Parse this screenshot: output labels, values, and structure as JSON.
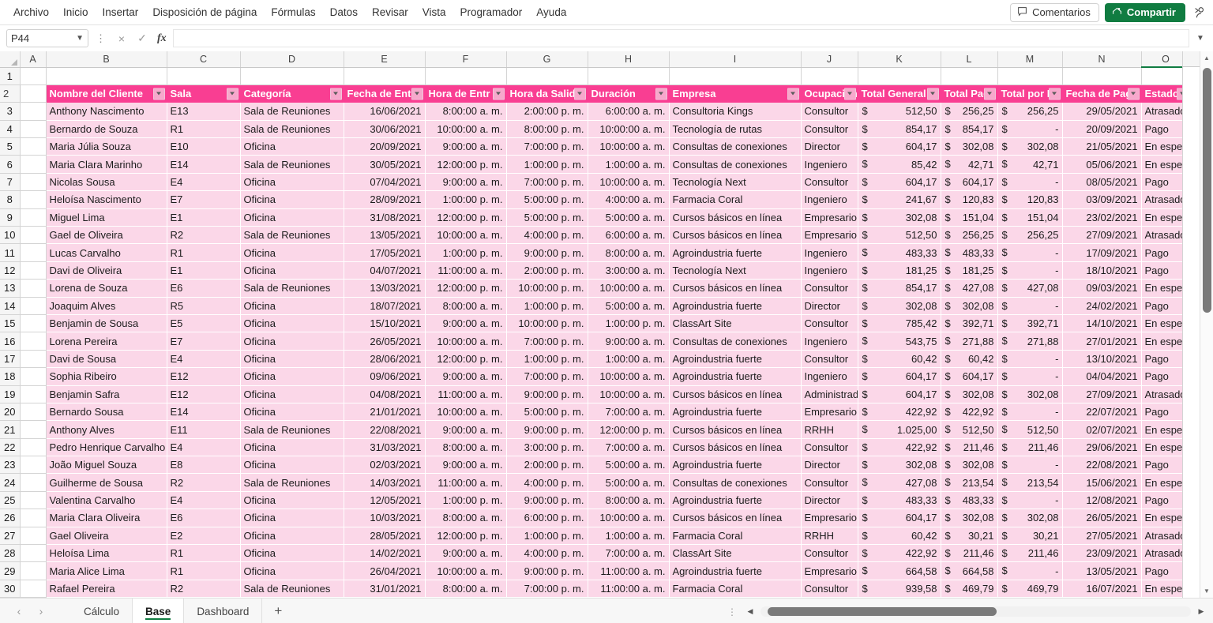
{
  "menu": {
    "items": [
      "Archivo",
      "Inicio",
      "Insertar",
      "Disposición de página",
      "Fórmulas",
      "Datos",
      "Revisar",
      "Vista",
      "Programador",
      "Ayuda"
    ],
    "comments_label": "Comentarios",
    "share_label": "Compartir"
  },
  "formula_bar": {
    "name_box": "P44",
    "formula": "",
    "cancel_icon": "×",
    "confirm_icon": "✓",
    "fx_label": "fx"
  },
  "grid": {
    "column_letters": [
      "A",
      "B",
      "C",
      "D",
      "E",
      "F",
      "G",
      "H",
      "I",
      "J",
      "K",
      "L",
      "M",
      "N",
      "O"
    ],
    "row_numbers": [
      1,
      2,
      3,
      4,
      5,
      6,
      7,
      8,
      9,
      10,
      11,
      12,
      13,
      14,
      15,
      16,
      17,
      18,
      19,
      20,
      21,
      22,
      23,
      24,
      25,
      26,
      27,
      28,
      29,
      30
    ],
    "header_row_index": 2,
    "header_fill": "#f93e92",
    "data_fill": "#fbd7e8",
    "headers": [
      "Nombre del Cliente",
      "Sala",
      "Categoría",
      "Fecha de Ent",
      "Hora de Entr",
      "Hora da Salid",
      "Duración",
      "Empresa",
      "Ocupación",
      "Total General",
      "Total Pag",
      "Total por P",
      "Fecha de Pag",
      "Estado"
    ],
    "rows": [
      {
        "n": 3,
        "cliente": "Anthony Nascimento",
        "sala": "E13",
        "categoria": "Sala de Reuniones",
        "entrada": "16/06/2021",
        "hora_entrada": "8:00:00 a. m.",
        "hora_salida": "2:00:00 p. m.",
        "duracion": "6:00:00 a. m.",
        "empresa": "Consultoria Kings",
        "ocupacion": "Consultor",
        "total_general": "512,50",
        "total_pagado": "256,25",
        "total_por_pagar": "256,25",
        "fecha_pago": "29/05/2021",
        "estado": "Atrasado"
      },
      {
        "n": 4,
        "cliente": "Bernardo de Souza",
        "sala": "R1",
        "categoria": "Sala de Reuniones",
        "entrada": "30/06/2021",
        "hora_entrada": "10:00:00 a. m.",
        "hora_salida": "8:00:00 p. m.",
        "duracion": "10:00:00 a. m.",
        "empresa": "Tecnología de rutas",
        "ocupacion": "Consultor",
        "total_general": "854,17",
        "total_pagado": "854,17",
        "total_por_pagar": "-",
        "fecha_pago": "20/09/2021",
        "estado": "Pago"
      },
      {
        "n": 5,
        "cliente": "Maria Júlia Souza",
        "sala": "E10",
        "categoria": "Oficina",
        "entrada": "20/09/2021",
        "hora_entrada": "9:00:00 a. m.",
        "hora_salida": "7:00:00 p. m.",
        "duracion": "10:00:00 a. m.",
        "empresa": "Consultas de conexiones",
        "ocupacion": "Director",
        "total_general": "604,17",
        "total_pagado": "302,08",
        "total_por_pagar": "302,08",
        "fecha_pago": "21/05/2021",
        "estado": "En espera"
      },
      {
        "n": 6,
        "cliente": "Maria Clara Marinho",
        "sala": "E14",
        "categoria": "Sala de Reuniones",
        "entrada": "30/05/2021",
        "hora_entrada": "12:00:00 p. m.",
        "hora_salida": "1:00:00 p. m.",
        "duracion": "1:00:00 a. m.",
        "empresa": "Consultas de conexiones",
        "ocupacion": "Ingeniero",
        "total_general": "85,42",
        "total_pagado": "42,71",
        "total_por_pagar": "42,71",
        "fecha_pago": "05/06/2021",
        "estado": "En espera"
      },
      {
        "n": 7,
        "cliente": "Nicolas Sousa",
        "sala": "E4",
        "categoria": "Oficina",
        "entrada": "07/04/2021",
        "hora_entrada": "9:00:00 a. m.",
        "hora_salida": "7:00:00 p. m.",
        "duracion": "10:00:00 a. m.",
        "empresa": "Tecnología Next",
        "ocupacion": "Consultor",
        "total_general": "604,17",
        "total_pagado": "604,17",
        "total_por_pagar": "-",
        "fecha_pago": "08/05/2021",
        "estado": "Pago"
      },
      {
        "n": 8,
        "cliente": "Heloísa Nascimento",
        "sala": "E7",
        "categoria": "Oficina",
        "entrada": "28/09/2021",
        "hora_entrada": "1:00:00 p. m.",
        "hora_salida": "5:00:00 p. m.",
        "duracion": "4:00:00 a. m.",
        "empresa": "Farmacia Coral",
        "ocupacion": "Ingeniero",
        "total_general": "241,67",
        "total_pagado": "120,83",
        "total_por_pagar": "120,83",
        "fecha_pago": "03/09/2021",
        "estado": "Atrasado"
      },
      {
        "n": 9,
        "cliente": "Miguel Lima",
        "sala": "E1",
        "categoria": "Oficina",
        "entrada": "31/08/2021",
        "hora_entrada": "12:00:00 p. m.",
        "hora_salida": "5:00:00 p. m.",
        "duracion": "5:00:00 a. m.",
        "empresa": "Cursos básicos en línea",
        "ocupacion": "Empresario",
        "total_general": "302,08",
        "total_pagado": "151,04",
        "total_por_pagar": "151,04",
        "fecha_pago": "23/02/2021",
        "estado": "En espera"
      },
      {
        "n": 10,
        "cliente": "Gael de Oliveira",
        "sala": "R2",
        "categoria": "Sala de Reuniones",
        "entrada": "13/05/2021",
        "hora_entrada": "10:00:00 a. m.",
        "hora_salida": "4:00:00 p. m.",
        "duracion": "6:00:00 a. m.",
        "empresa": "Cursos básicos en línea",
        "ocupacion": "Empresario",
        "total_general": "512,50",
        "total_pagado": "256,25",
        "total_por_pagar": "256,25",
        "fecha_pago": "27/09/2021",
        "estado": "Atrasado"
      },
      {
        "n": 11,
        "cliente": "Lucas Carvalho",
        "sala": "R1",
        "categoria": "Oficina",
        "entrada": "17/05/2021",
        "hora_entrada": "1:00:00 p. m.",
        "hora_salida": "9:00:00 p. m.",
        "duracion": "8:00:00 a. m.",
        "empresa": "Agroindustria fuerte",
        "ocupacion": "Ingeniero",
        "total_general": "483,33",
        "total_pagado": "483,33",
        "total_por_pagar": "-",
        "fecha_pago": "17/09/2021",
        "estado": "Pago"
      },
      {
        "n": 12,
        "cliente": "Davi de Oliveira",
        "sala": "E1",
        "categoria": "Oficina",
        "entrada": "04/07/2021",
        "hora_entrada": "11:00:00 a. m.",
        "hora_salida": "2:00:00 p. m.",
        "duracion": "3:00:00 a. m.",
        "empresa": "Tecnología Next",
        "ocupacion": "Ingeniero",
        "total_general": "181,25",
        "total_pagado": "181,25",
        "total_por_pagar": "-",
        "fecha_pago": "18/10/2021",
        "estado": "Pago"
      },
      {
        "n": 13,
        "cliente": "Lorena de Souza",
        "sala": "E6",
        "categoria": "Sala de Reuniones",
        "entrada": "13/03/2021",
        "hora_entrada": "12:00:00 p. m.",
        "hora_salida": "10:00:00 p. m.",
        "duracion": "10:00:00 a. m.",
        "empresa": "Cursos básicos en línea",
        "ocupacion": "Consultor",
        "total_general": "854,17",
        "total_pagado": "427,08",
        "total_por_pagar": "427,08",
        "fecha_pago": "09/03/2021",
        "estado": "En espera"
      },
      {
        "n": 14,
        "cliente": "Joaquim Alves",
        "sala": "R5",
        "categoria": "Oficina",
        "entrada": "18/07/2021",
        "hora_entrada": "8:00:00 a. m.",
        "hora_salida": "1:00:00 p. m.",
        "duracion": "5:00:00 a. m.",
        "empresa": "Agroindustria fuerte",
        "ocupacion": "Director",
        "total_general": "302,08",
        "total_pagado": "302,08",
        "total_por_pagar": "-",
        "fecha_pago": "24/02/2021",
        "estado": "Pago"
      },
      {
        "n": 15,
        "cliente": "Benjamin de Sousa",
        "sala": "E5",
        "categoria": "Oficina",
        "entrada": "15/10/2021",
        "hora_entrada": "9:00:00 a. m.",
        "hora_salida": "10:00:00 p. m.",
        "duracion": "1:00:00 p. m.",
        "empresa": "ClassArt Site",
        "ocupacion": "Consultor",
        "total_general": "785,42",
        "total_pagado": "392,71",
        "total_por_pagar": "392,71",
        "fecha_pago": "14/10/2021",
        "estado": "En espera"
      },
      {
        "n": 16,
        "cliente": "Lorena Pereira",
        "sala": "E7",
        "categoria": "Oficina",
        "entrada": "26/05/2021",
        "hora_entrada": "10:00:00 a. m.",
        "hora_salida": "7:00:00 p. m.",
        "duracion": "9:00:00 a. m.",
        "empresa": "Consultas de conexiones",
        "ocupacion": "Ingeniero",
        "total_general": "543,75",
        "total_pagado": "271,88",
        "total_por_pagar": "271,88",
        "fecha_pago": "27/01/2021",
        "estado": "En espera"
      },
      {
        "n": 17,
        "cliente": "Davi de Sousa",
        "sala": "E4",
        "categoria": "Oficina",
        "entrada": "28/06/2021",
        "hora_entrada": "12:00:00 p. m.",
        "hora_salida": "1:00:00 p. m.",
        "duracion": "1:00:00 a. m.",
        "empresa": "Agroindustria fuerte",
        "ocupacion": "Consultor",
        "total_general": "60,42",
        "total_pagado": "60,42",
        "total_por_pagar": "-",
        "fecha_pago": "13/10/2021",
        "estado": "Pago"
      },
      {
        "n": 18,
        "cliente": "Sophia Ribeiro",
        "sala": "E12",
        "categoria": "Oficina",
        "entrada": "09/06/2021",
        "hora_entrada": "9:00:00 a. m.",
        "hora_salida": "7:00:00 p. m.",
        "duracion": "10:00:00 a. m.",
        "empresa": "Agroindustria fuerte",
        "ocupacion": "Ingeniero",
        "total_general": "604,17",
        "total_pagado": "604,17",
        "total_por_pagar": "-",
        "fecha_pago": "04/04/2021",
        "estado": "Pago"
      },
      {
        "n": 19,
        "cliente": "Benjamin Safra",
        "sala": "E12",
        "categoria": "Oficina",
        "entrada": "04/08/2021",
        "hora_entrada": "11:00:00 a. m.",
        "hora_salida": "9:00:00 p. m.",
        "duracion": "10:00:00 a. m.",
        "empresa": "Cursos básicos en línea",
        "ocupacion": "Administrado",
        "total_general": "604,17",
        "total_pagado": "302,08",
        "total_por_pagar": "302,08",
        "fecha_pago": "27/09/2021",
        "estado": "Atrasado"
      },
      {
        "n": 20,
        "cliente": "Bernardo Sousa",
        "sala": "E14",
        "categoria": "Oficina",
        "entrada": "21/01/2021",
        "hora_entrada": "10:00:00 a. m.",
        "hora_salida": "5:00:00 p. m.",
        "duracion": "7:00:00 a. m.",
        "empresa": "Agroindustria fuerte",
        "ocupacion": "Empresario",
        "total_general": "422,92",
        "total_pagado": "422,92",
        "total_por_pagar": "-",
        "fecha_pago": "22/07/2021",
        "estado": "Pago"
      },
      {
        "n": 21,
        "cliente": "Anthony Alves",
        "sala": "E11",
        "categoria": "Sala de Reuniones",
        "entrada": "22/08/2021",
        "hora_entrada": "9:00:00 a. m.",
        "hora_salida": "9:00:00 p. m.",
        "duracion": "12:00:00 p. m.",
        "empresa": "Cursos básicos en línea",
        "ocupacion": "RRHH",
        "total_general": "1.025,00",
        "total_pagado": "512,50",
        "total_por_pagar": "512,50",
        "fecha_pago": "02/07/2021",
        "estado": "En espera"
      },
      {
        "n": 22,
        "cliente": "Pedro Henrique Carvalho",
        "sala": "E4",
        "categoria": "Oficina",
        "entrada": "31/03/2021",
        "hora_entrada": "8:00:00 a. m.",
        "hora_salida": "3:00:00 p. m.",
        "duracion": "7:00:00 a. m.",
        "empresa": "Cursos básicos en línea",
        "ocupacion": "Consultor",
        "total_general": "422,92",
        "total_pagado": "211,46",
        "total_por_pagar": "211,46",
        "fecha_pago": "29/06/2021",
        "estado": "En espera"
      },
      {
        "n": 23,
        "cliente": "João Miguel Souza",
        "sala": "E8",
        "categoria": "Oficina",
        "entrada": "02/03/2021",
        "hora_entrada": "9:00:00 a. m.",
        "hora_salida": "2:00:00 p. m.",
        "duracion": "5:00:00 a. m.",
        "empresa": "Agroindustria fuerte",
        "ocupacion": "Director",
        "total_general": "302,08",
        "total_pagado": "302,08",
        "total_por_pagar": "-",
        "fecha_pago": "22/08/2021",
        "estado": "Pago"
      },
      {
        "n": 24,
        "cliente": "Guilherme de Sousa",
        "sala": "R2",
        "categoria": "Sala de Reuniones",
        "entrada": "14/03/2021",
        "hora_entrada": "11:00:00 a. m.",
        "hora_salida": "4:00:00 p. m.",
        "duracion": "5:00:00 a. m.",
        "empresa": "Consultas de conexiones",
        "ocupacion": "Consultor",
        "total_general": "427,08",
        "total_pagado": "213,54",
        "total_por_pagar": "213,54",
        "fecha_pago": "15/06/2021",
        "estado": "En espera"
      },
      {
        "n": 25,
        "cliente": "Valentina Carvalho",
        "sala": "E4",
        "categoria": "Oficina",
        "entrada": "12/05/2021",
        "hora_entrada": "1:00:00 p. m.",
        "hora_salida": "9:00:00 p. m.",
        "duracion": "8:00:00 a. m.",
        "empresa": "Agroindustria fuerte",
        "ocupacion": "Director",
        "total_general": "483,33",
        "total_pagado": "483,33",
        "total_por_pagar": "-",
        "fecha_pago": "12/08/2021",
        "estado": "Pago"
      },
      {
        "n": 26,
        "cliente": "Maria Clara Oliveira",
        "sala": "E6",
        "categoria": "Oficina",
        "entrada": "10/03/2021",
        "hora_entrada": "8:00:00 a. m.",
        "hora_salida": "6:00:00 p. m.",
        "duracion": "10:00:00 a. m.",
        "empresa": "Cursos básicos en línea",
        "ocupacion": "Empresario",
        "total_general": "604,17",
        "total_pagado": "302,08",
        "total_por_pagar": "302,08",
        "fecha_pago": "26/05/2021",
        "estado": "En espera"
      },
      {
        "n": 27,
        "cliente": "Gael Oliveira",
        "sala": "E2",
        "categoria": "Oficina",
        "entrada": "28/05/2021",
        "hora_entrada": "12:00:00 p. m.",
        "hora_salida": "1:00:00 p. m.",
        "duracion": "1:00:00 a. m.",
        "empresa": "Farmacia Coral",
        "ocupacion": "RRHH",
        "total_general": "60,42",
        "total_pagado": "30,21",
        "total_por_pagar": "30,21",
        "fecha_pago": "27/05/2021",
        "estado": "Atrasado"
      },
      {
        "n": 28,
        "cliente": "Heloísa Lima",
        "sala": "R1",
        "categoria": "Oficina",
        "entrada": "14/02/2021",
        "hora_entrada": "9:00:00 a. m.",
        "hora_salida": "4:00:00 p. m.",
        "duracion": "7:00:00 a. m.",
        "empresa": "ClassArt Site",
        "ocupacion": "Consultor",
        "total_general": "422,92",
        "total_pagado": "211,46",
        "total_por_pagar": "211,46",
        "fecha_pago": "23/09/2021",
        "estado": "Atrasado"
      },
      {
        "n": 29,
        "cliente": "Maria Alice Lima",
        "sala": "R1",
        "categoria": "Oficina",
        "entrada": "26/04/2021",
        "hora_entrada": "10:00:00 a. m.",
        "hora_salida": "9:00:00 p. m.",
        "duracion": "11:00:00 a. m.",
        "empresa": "Agroindustria fuerte",
        "ocupacion": "Empresario",
        "total_general": "664,58",
        "total_pagado": "664,58",
        "total_por_pagar": "-",
        "fecha_pago": "13/05/2021",
        "estado": "Pago"
      },
      {
        "n": 30,
        "cliente": "Rafael Pereira",
        "sala": "R2",
        "categoria": "Sala de Reuniones",
        "entrada": "31/01/2021",
        "hora_entrada": "8:00:00 a. m.",
        "hora_salida": "7:00:00 p. m.",
        "duracion": "11:00:00 a. m.",
        "empresa": "Farmacia Coral",
        "ocupacion": "Consultor",
        "total_general": "939,58",
        "total_pagado": "469,79",
        "total_por_pagar": "469,79",
        "fecha_pago": "16/07/2021",
        "estado": "En espera"
      }
    ],
    "currency_symbol": "$"
  },
  "sheet_tabs": {
    "prev_icon": "‹",
    "next_icon": "›",
    "tabs": [
      {
        "label": "Cálculo",
        "active": false
      },
      {
        "label": "Base",
        "active": true
      },
      {
        "label": "Dashboard",
        "active": false
      }
    ],
    "add_label": "+"
  }
}
